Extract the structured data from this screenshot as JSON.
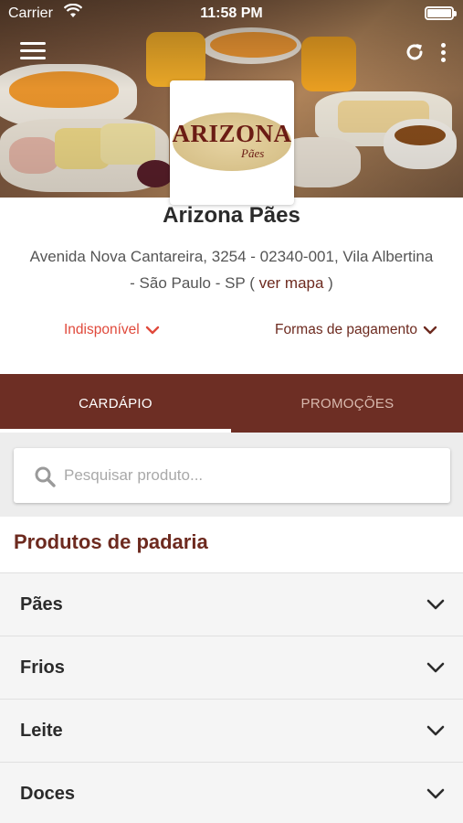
{
  "status_bar": {
    "carrier": "Carrier",
    "time": "11:58 PM"
  },
  "store": {
    "name": "Arizona Pães",
    "logo_text": "ARIZONA",
    "logo_subtext": "Pães",
    "address": "Avenida Nova Cantareira, 3254 - 02340-001, Vila Albertina - São Paulo - SP",
    "map_link_open": " ( ",
    "map_link": "ver mapa",
    "map_link_close": " )",
    "availability": "Indisponível",
    "payment_methods": "Formas de pagamento"
  },
  "tabs": [
    {
      "label": "CARDÁPIO",
      "active": true
    },
    {
      "label": "PROMOÇÕES",
      "active": false
    }
  ],
  "search": {
    "placeholder": "Pesquisar produto..."
  },
  "products": {
    "section_title": "Produtos de padaria",
    "categories": [
      "Pães",
      "Frios",
      "Leite",
      "Doces"
    ]
  },
  "colors": {
    "brand": "#6d2e24",
    "unavailable": "#e0493b",
    "link": "#6d2a1f"
  }
}
